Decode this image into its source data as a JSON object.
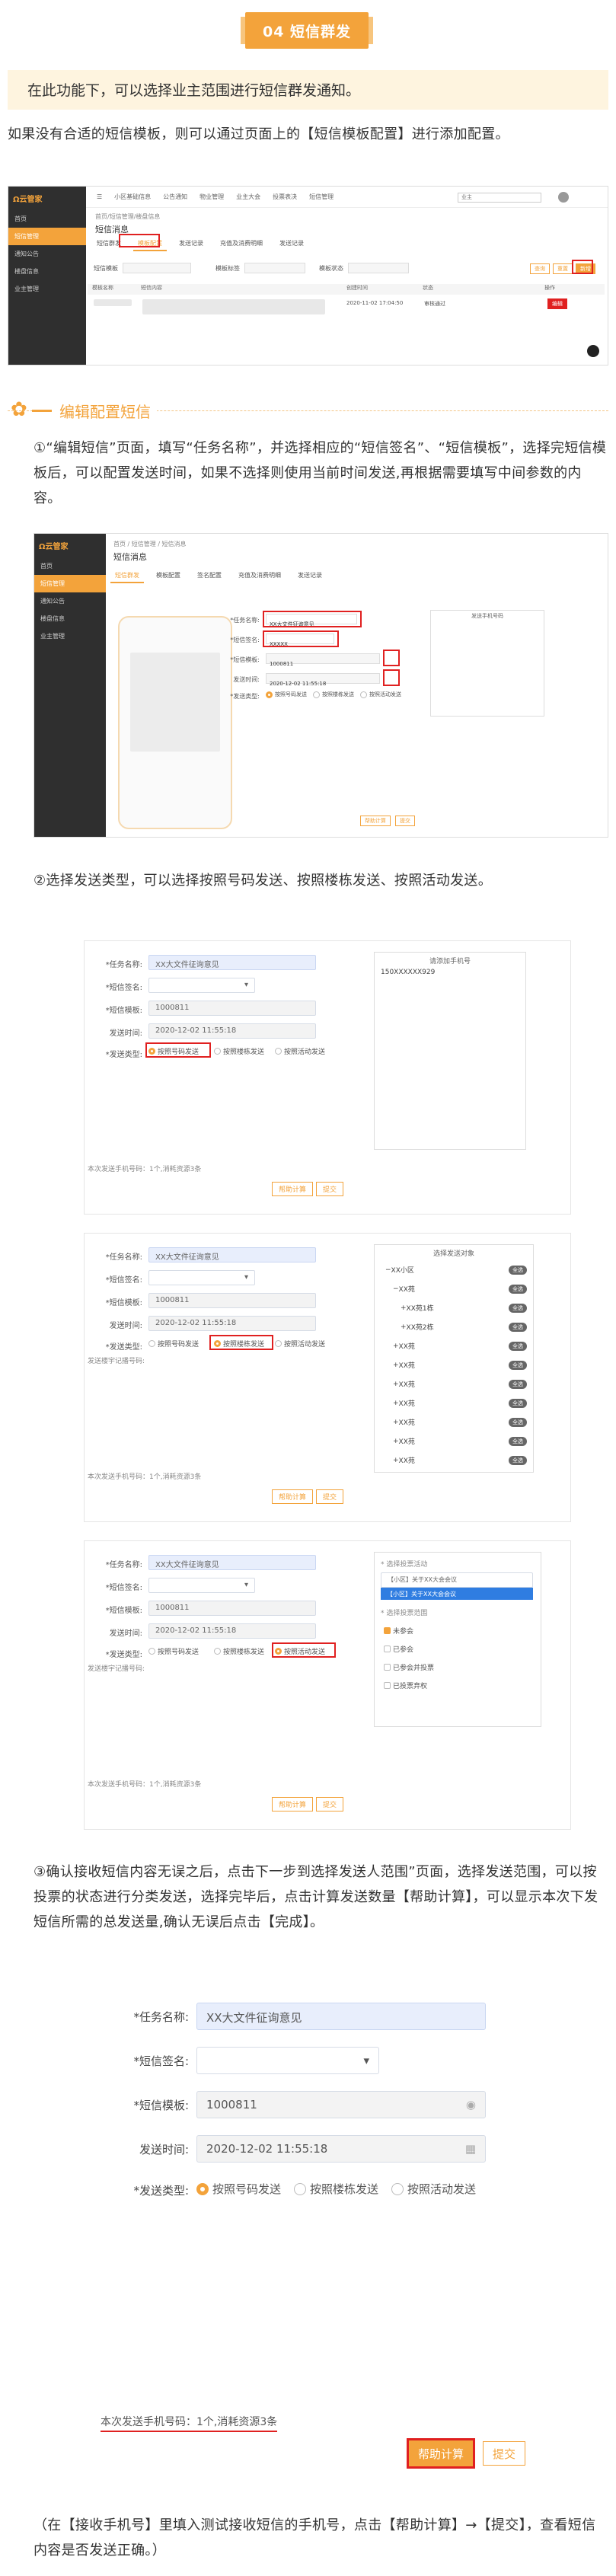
{
  "badge": "04 短信群发",
  "note": "在此功能下，可以选择业主范围进行短信群发通知。",
  "intro": "如果没有合适的短信模板，则可以通过页面上的【短信模板配置】进行添加配置。",
  "shot1": {
    "logo": "Ω云管家",
    "sidebar": [
      "首页",
      "短信管理",
      "通知公告",
      "楼盘信息",
      "业主管理"
    ],
    "topbar": [
      "小区基础信息",
      "公告通知",
      "物业管理",
      "业主大会",
      "投票表决",
      "短信管理"
    ],
    "user": "业主",
    "crumb": "首页/短信管理/楼盘信息",
    "title": "短信消息",
    "tabs": [
      "短信群发",
      "模板配置",
      "发送记录",
      "充值及消费明细",
      "发送记录"
    ],
    "filters": [
      "短信模板",
      "模板标签",
      "模板状态"
    ],
    "columns": [
      "模板名称",
      "短信内容",
      "创建时间",
      "状态",
      "操作"
    ],
    "row_time": "2020-11-02 17:04:50",
    "row_status": "审核通过",
    "row_action": "编辑",
    "buttons": [
      "查询",
      "重置",
      "新增"
    ]
  },
  "section_title": "编辑配置短信",
  "step1": "①“编辑短信”页面，填写“任务名称”，并选择相应的“短信签名”、“短信模板”，选择完短信模板后，可以配置发送时间，如果不选择则使用当前时间发送,再根据需要填写中间参数的内容。",
  "shot2": {
    "crumb": "首页 / 短信管理 / 短信消息",
    "title": "短信消息",
    "tabs": [
      "短信群发",
      "模板配置",
      "签名配置",
      "充值及消费明细",
      "发送记录"
    ],
    "labels": [
      "*任务名称:",
      "*短信签名:",
      "*短信模板:",
      "发送时间:",
      "*发送类型:"
    ],
    "values": [
      "XX大文件征询意见",
      "XXXXX",
      "1000811",
      "2020-12-02 11:55:18"
    ],
    "radios": [
      "按照号码发送",
      "按照楼栋发送",
      "按照活动发送"
    ],
    "right_title": "发送手机号码",
    "buttons": [
      "帮助计算",
      "提交"
    ]
  },
  "step2": "②选择发送类型，可以选择按照号码发送、按照楼栋发送、按照活动发送。",
  "shot3": {
    "labels": [
      "*任务名称:",
      "*短信签名:",
      "*短信模板:",
      "发送时间:",
      "*发送类型:"
    ],
    "task": "XX大文件征询意见",
    "template": "1000811",
    "time": "2020-12-02 11:55:18",
    "radios": [
      "按照号码发送",
      "按照楼栋发送",
      "按照活动发送"
    ],
    "phones_title": "请添加手机号",
    "phone_sample": "150XXXXXX929",
    "extra_label": "发送楼宇记播号码:",
    "count_note": "本次发送手机号码：1个,消耗资源3条",
    "tree_title": "选择发送对象",
    "tree_items": [
      "XX小区",
      "XX苑",
      "XX苑1栋",
      "XX苑2栋",
      "XX苑",
      "XX苑",
      "XX苑",
      "XX苑",
      "XX苑",
      "XX苑",
      "XX苑"
    ],
    "tree_pill": "全选",
    "activity_label": "* 选择投票活动",
    "activity_value": "【小区】关于XX大会会议",
    "activity_option": "【小区】关于XX大会会议",
    "scope_label": "* 选择投票范围",
    "scopes": [
      "未参会",
      "已参会",
      "已参会并投票",
      "已投票弃权"
    ],
    "buttons": [
      "帮助计算",
      "提交"
    ]
  },
  "step3": "③确认接收短信内容无误之后，点击下一步到选择发送人范围”页面，选择发送范围，可以按投票的状态进行分类发送，选择完毕后，点击计算发送数量【帮助计算】，可以显示本次下发短信所需的总发送量,确认无误后点击【完成】。",
  "shot4": {
    "labels": [
      "*任务名称:",
      "*短信签名:",
      "*短信模板:",
      "发送时间:",
      "*发送类型:"
    ],
    "task": "XX大文件征询意见",
    "template": "1000811",
    "time": "2020-12-02 11:55:18",
    "radios": [
      "按照号码发送",
      "按照楼栋发送",
      "按照活动发送"
    ],
    "count_note": "本次发送手机号码：1个,消耗资源3条",
    "buttons": [
      "帮助计算",
      "提交"
    ]
  },
  "footer": "（在【接收手机号】里填入测试接收短信的手机号，点击【帮助计算】→【提交】，查看短信内容是否发送正确。）",
  "colors": {
    "accent": "#f3a33b",
    "highlight": "#e02020"
  }
}
